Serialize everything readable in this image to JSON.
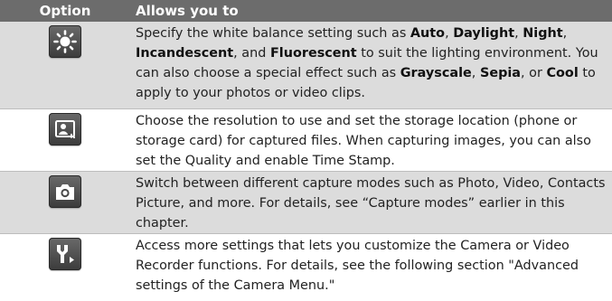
{
  "header": {
    "option": "Option",
    "allows": "Allows you to"
  },
  "rows": [
    {
      "icon": "white-balance-sun-icon",
      "parts": [
        {
          "t": "Specify the white balance setting such as "
        },
        {
          "t": "Auto",
          "b": true
        },
        {
          "t": ", "
        },
        {
          "t": "Daylight",
          "b": true
        },
        {
          "t": ", "
        },
        {
          "t": "Night",
          "b": true
        },
        {
          "t": ", "
        },
        {
          "t": "Incandescent",
          "b": true
        },
        {
          "t": ", and "
        },
        {
          "t": "Fluorescent",
          "b": true
        },
        {
          "t": " to suit the lighting environment. You can also choose a special effect such as "
        },
        {
          "t": "Grayscale",
          "b": true
        },
        {
          "t": ", "
        },
        {
          "t": "Sepia",
          "b": true
        },
        {
          "t": ", or "
        },
        {
          "t": "Cool",
          "b": true
        },
        {
          "t": " to apply to your photos or video clips."
        }
      ]
    },
    {
      "icon": "resolution-image-icon",
      "parts": [
        {
          "t": "Choose the resolution to use and set the storage location (phone or storage card) for captured files. When capturing images, you can also set the Quality and enable Time Stamp."
        }
      ]
    },
    {
      "icon": "camera-icon",
      "parts": [
        {
          "t": "Switch between different capture modes such as Photo, Video, Contacts Picture, and more. For details, see “Capture modes” earlier in this chapter."
        }
      ]
    },
    {
      "icon": "settings-tools-icon",
      "parts": [
        {
          "t": "Access more settings that lets you customize the Camera or Video Recorder functions. For details, see the following section \"Advanced settings of the Camera Menu.\""
        }
      ]
    }
  ]
}
